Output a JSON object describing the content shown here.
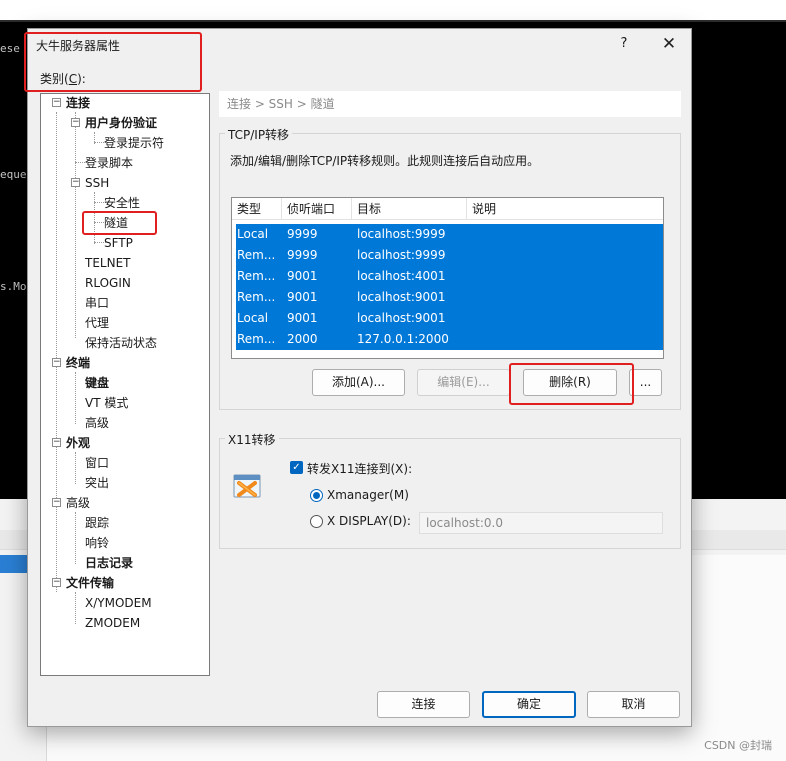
{
  "background": {
    "terminal_lines": [
      "ese",
      "eque",
      "s.Mo"
    ],
    "watermark": "CSDN @封瑞"
  },
  "dialog": {
    "title": "大牛服务器属性",
    "help": "?",
    "close": "✕",
    "category_label": "类别(",
    "category_key": "C",
    "category_suffix": "):"
  },
  "tree": {
    "items": [
      {
        "label": "连接",
        "bold": true
      },
      {
        "label": "用户身份验证",
        "bold": true
      },
      {
        "label": "登录提示符",
        "bold": false
      },
      {
        "label": "登录脚本",
        "bold": false
      },
      {
        "label": "SSH",
        "bold": false
      },
      {
        "label": "安全性",
        "bold": false
      },
      {
        "label": "隧道",
        "bold": false
      },
      {
        "label": "SFTP",
        "bold": false
      },
      {
        "label": "TELNET",
        "bold": false
      },
      {
        "label": "RLOGIN",
        "bold": false
      },
      {
        "label": "串口",
        "bold": false
      },
      {
        "label": "代理",
        "bold": false
      },
      {
        "label": "保持活动状态",
        "bold": false
      },
      {
        "label": "终端",
        "bold": true
      },
      {
        "label": "键盘",
        "bold": true
      },
      {
        "label": "VT 模式",
        "bold": false
      },
      {
        "label": "高级",
        "bold": false
      },
      {
        "label": "外观",
        "bold": true
      },
      {
        "label": "窗口",
        "bold": false
      },
      {
        "label": "突出",
        "bold": false
      },
      {
        "label": "高级",
        "bold": false
      },
      {
        "label": "跟踪",
        "bold": false
      },
      {
        "label": "响铃",
        "bold": false
      },
      {
        "label": "日志记录",
        "bold": true
      },
      {
        "label": "文件传输",
        "bold": true
      },
      {
        "label": "X/YMODEM",
        "bold": false
      },
      {
        "label": "ZMODEM",
        "bold": false
      }
    ],
    "selected": "隧道"
  },
  "breadcrumb": "连接 > SSH > 隧道",
  "tcpip": {
    "group_title": "TCP/IP转移",
    "description": "添加/编辑/删除TCP/IP转移规则。此规则连接后自动应用。",
    "columns": [
      "类型",
      "侦听端口",
      "目标",
      "说明"
    ],
    "rows": [
      {
        "type": "Local",
        "port": "9999",
        "target": "localhost:9999",
        "note": ""
      },
      {
        "type": "Rem...",
        "port": "9999",
        "target": "localhost:9999",
        "note": ""
      },
      {
        "type": "Rem...",
        "port": "9001",
        "target": "localhost:4001",
        "note": ""
      },
      {
        "type": "Rem...",
        "port": "9001",
        "target": "localhost:9001",
        "note": ""
      },
      {
        "type": "Local",
        "port": "9001",
        "target": "localhost:9001",
        "note": ""
      },
      {
        "type": "Rem...",
        "port": "2000",
        "target": "127.0.0.1:2000",
        "note": ""
      }
    ],
    "add_btn": "添加(A)...",
    "edit_btn": "编辑(E)...",
    "delete_btn": "删除(R)",
    "more_btn": "..."
  },
  "x11": {
    "group_title": "X11转移",
    "forward_label": "转发X11连接到(X):",
    "forward_checked": true,
    "option_xmanager": "Xmanager(M)",
    "option_display": "X DISPLAY(D):",
    "selected_option": "Xmanager(M)",
    "display_value": "localhost:0.0"
  },
  "footer": {
    "connect_btn": "连接",
    "ok_btn": "确定",
    "cancel_btn": "取消"
  }
}
